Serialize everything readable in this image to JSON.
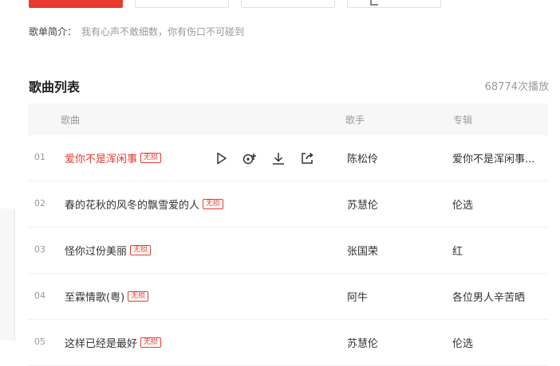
{
  "top_buttons": [
    "",
    "",
    "",
    ""
  ],
  "intro": {
    "label": "歌单简介：",
    "text": "我有心声不敢细数，你有伤口不可碰到"
  },
  "list": {
    "title": "歌曲列表",
    "play_count": "68774次播放"
  },
  "table": {
    "headers": {
      "song": "歌曲",
      "singer": "歌手",
      "album": "专辑"
    },
    "rows": [
      {
        "num": "01",
        "song": "爱你不是浑闲事",
        "badge": "无损",
        "singer": "陈松伶",
        "album": "爱你不是浑闲事..."
      },
      {
        "num": "02",
        "song": "春的花秋的风冬的飘雪爱的人",
        "badge": "无损",
        "singer": "苏慧伦",
        "album": "伦选"
      },
      {
        "num": "03",
        "song": "怪你过份美丽",
        "badge": "无损",
        "singer": "张国荣",
        "album": "红"
      },
      {
        "num": "04",
        "song": "至霖情歌(粤)",
        "badge": "无损",
        "singer": "阿牛",
        "album": "各位男人辛苦晒"
      },
      {
        "num": "05",
        "song": "这样已经是最好",
        "badge": "无损",
        "singer": "苏慧伦",
        "album": "伦选"
      }
    ]
  },
  "row_actions": [
    "play-icon",
    "add-to-playlist-icon",
    "download-icon",
    "share-icon"
  ],
  "colors": {
    "accent": "#e83b2f",
    "muted": "#999999",
    "header_bg": "#f7f7f7"
  }
}
